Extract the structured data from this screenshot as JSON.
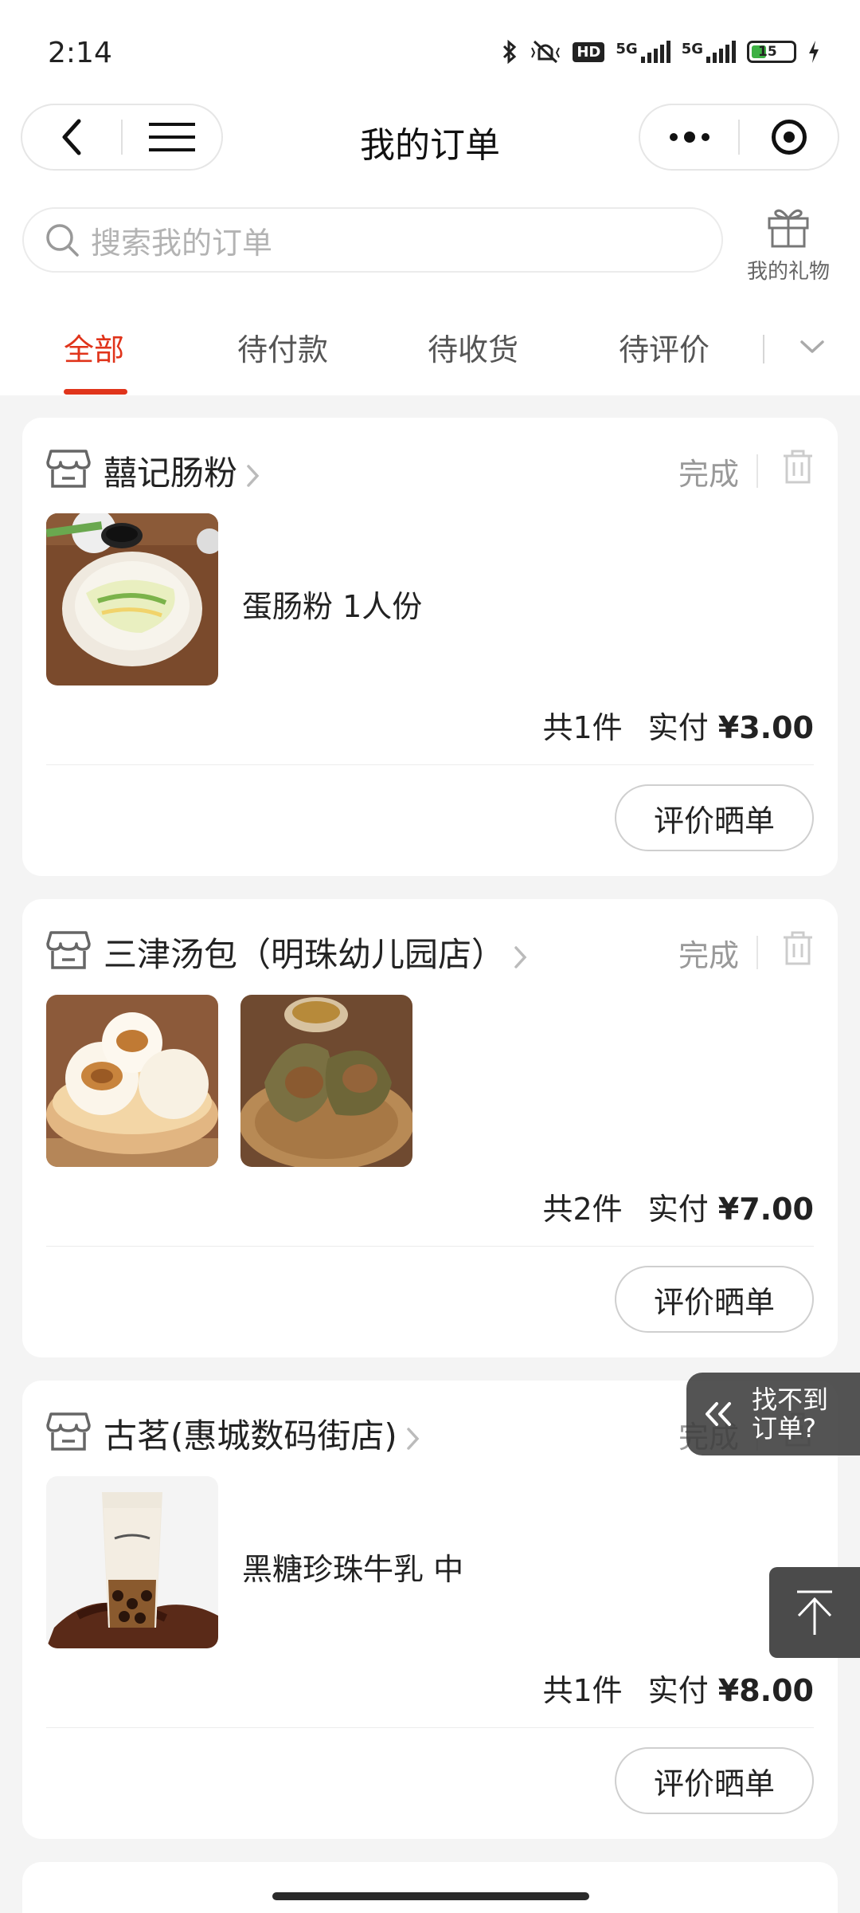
{
  "status_bar": {
    "time": "2:14",
    "hd": "HD",
    "net1": "5G",
    "net2": "5G",
    "battery": "15"
  },
  "nav": {
    "title": "我的订单"
  },
  "search": {
    "placeholder": "搜索我的订单"
  },
  "gift": {
    "label": "我的礼物"
  },
  "tabs": [
    {
      "label": "全部",
      "active": true
    },
    {
      "label": "待付款",
      "active": false
    },
    {
      "label": "待收货",
      "active": false
    },
    {
      "label": "待评价",
      "active": false
    }
  ],
  "orders": [
    {
      "store": "囍记肠粉",
      "status": "完成",
      "product": "蛋肠粉 1人份",
      "count": "共1件",
      "paid_label": "实付",
      "price": "¥3.00",
      "action": "评价晒单"
    },
    {
      "store": "三津汤包（明珠幼儿园店）",
      "status": "完成",
      "product": "",
      "count": "共2件",
      "paid_label": "实付",
      "price": "¥7.00",
      "action": "评价晒单"
    },
    {
      "store": "古茗(惠城数码街店)",
      "status": "完成",
      "product": "黑糖珍珠牛乳 中",
      "count": "共1件",
      "paid_label": "实付",
      "price": "¥8.00",
      "action": "评价晒单"
    }
  ],
  "float_find": {
    "label": "找不到订单?"
  },
  "colors": {
    "accent": "#e0341b",
    "muted": "#999999"
  }
}
